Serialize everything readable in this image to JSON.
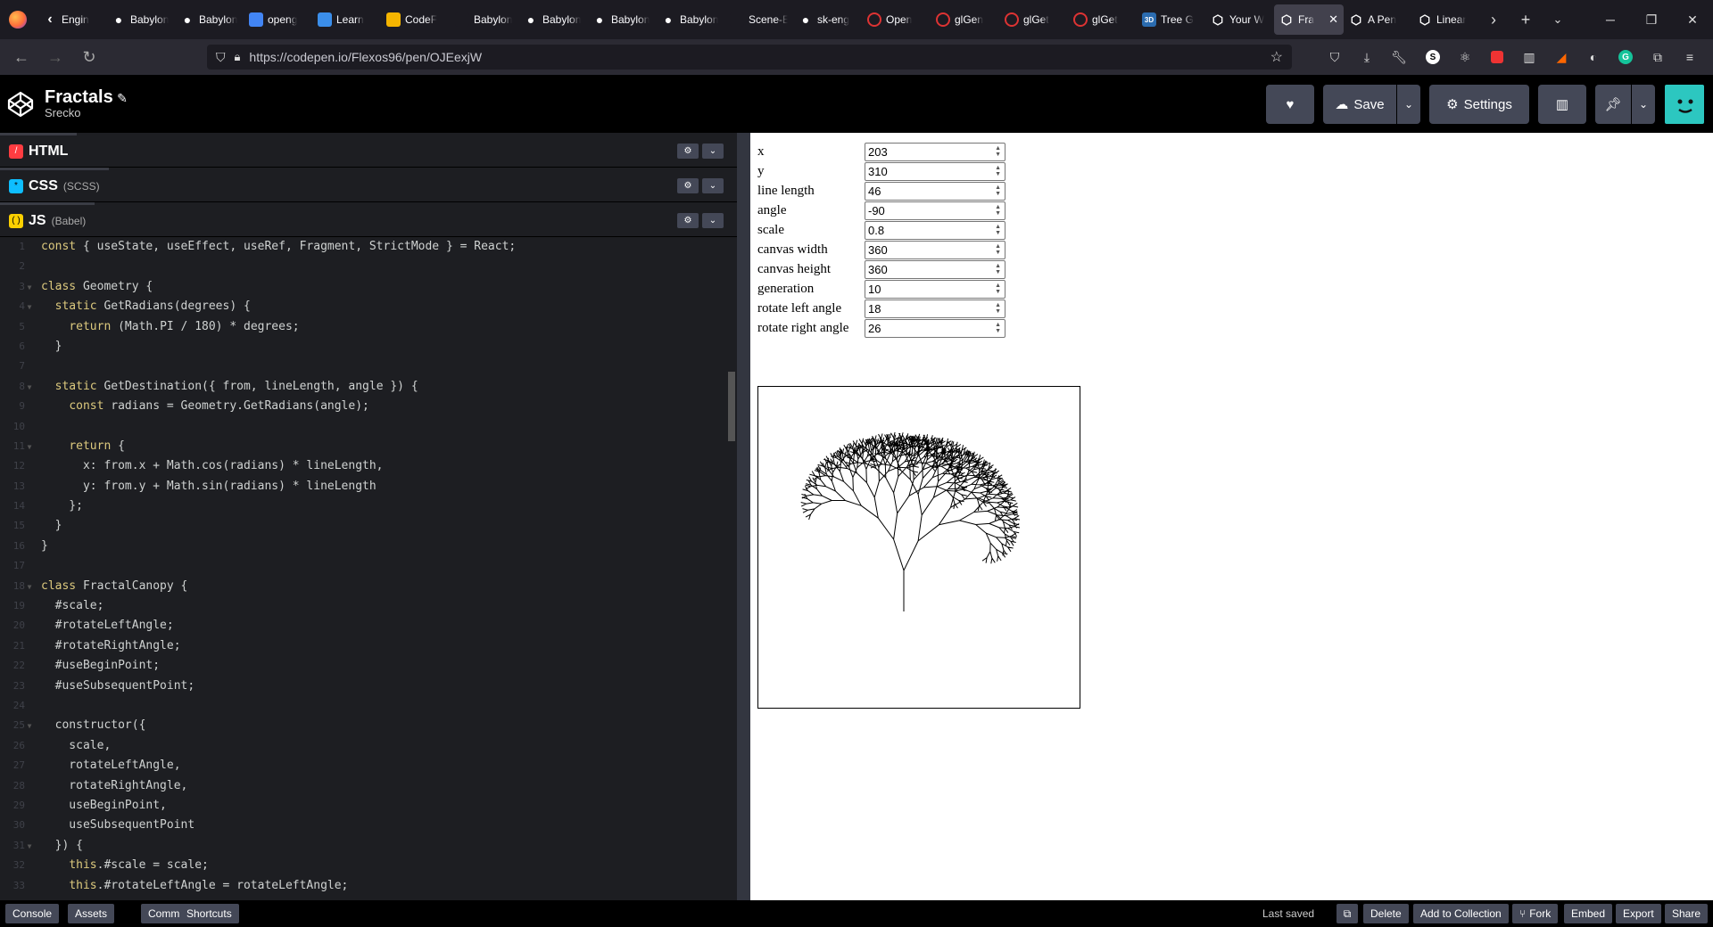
{
  "browser": {
    "tabs": [
      {
        "label": "Engin",
        "icon": "back-icon",
        "color": "#aaa"
      },
      {
        "label": "Babylon",
        "icon": "github-icon",
        "color": "#fff"
      },
      {
        "label": "Babylon",
        "icon": "github-icon",
        "color": "#fff"
      },
      {
        "label": "openg",
        "icon": "google-icon",
        "color": "#4285f4"
      },
      {
        "label": "Learn",
        "icon": "microsoft-icon",
        "color": "#3b8eea"
      },
      {
        "label": "CodeF",
        "icon": "chart-icon",
        "color": "#f4b400"
      },
      {
        "label": "Babylon",
        "icon": "blank-icon",
        "color": "#1c1b22"
      },
      {
        "label": "Babylon",
        "icon": "github-icon",
        "color": "#fff"
      },
      {
        "label": "Babylon",
        "icon": "github-icon",
        "color": "#fff"
      },
      {
        "label": "Babylon",
        "icon": "github-icon",
        "color": "#fff"
      },
      {
        "label": "Scene-Eng",
        "icon": "blank-icon",
        "color": "#1c1b22"
      },
      {
        "label": "sk-eng",
        "icon": "github-icon",
        "color": "#fff"
      },
      {
        "label": "Open",
        "icon": "opengl-icon",
        "color": "#d33"
      },
      {
        "label": "glGen",
        "icon": "opengl-icon",
        "color": "#d33"
      },
      {
        "label": "glGet",
        "icon": "opengl-icon",
        "color": "#d33"
      },
      {
        "label": "glGet",
        "icon": "opengl-icon",
        "color": "#d33"
      },
      {
        "label": "Tree G",
        "icon": "3d-icon",
        "color": "#2b6cb0"
      },
      {
        "label": "Your W",
        "icon": "codepen-icon",
        "color": "#fff"
      },
      {
        "label": "Fra",
        "icon": "codepen-icon",
        "color": "#fff",
        "active": true
      },
      {
        "label": "A Pen",
        "icon": "codepen-icon",
        "color": "#fff"
      },
      {
        "label": "Linear",
        "icon": "codepen-icon",
        "color": "#fff"
      }
    ],
    "url": "https://codepen.io/Flexos96/pen/OJEexjW"
  },
  "header": {
    "title": "Fractals",
    "author": "Srecko",
    "save_label": "Save",
    "settings_label": "Settings"
  },
  "editors": {
    "html_label": "HTML",
    "css_label": "CSS",
    "css_sub": "(SCSS)",
    "js_label": "JS",
    "js_sub": "(Babel)"
  },
  "code_lines": [
    {
      "n": "1",
      "t": "const { useState, useEffect, useRef, Fragment, StrictMode } = React;"
    },
    {
      "n": "2",
      "t": ""
    },
    {
      "n": "3",
      "t": "class Geometry {",
      "f": true
    },
    {
      "n": "4",
      "t": "  static GetRadians(degrees) {",
      "f": true
    },
    {
      "n": "5",
      "t": "    return (Math.PI / 180) * degrees;"
    },
    {
      "n": "6",
      "t": "  }"
    },
    {
      "n": "7",
      "t": ""
    },
    {
      "n": "8",
      "t": "  static GetDestination({ from, lineLength, angle }) {",
      "f": true
    },
    {
      "n": "9",
      "t": "    const radians = Geometry.GetRadians(angle);"
    },
    {
      "n": "10",
      "t": ""
    },
    {
      "n": "11",
      "t": "    return {",
      "f": true
    },
    {
      "n": "12",
      "t": "      x: from.x + Math.cos(radians) * lineLength,"
    },
    {
      "n": "13",
      "t": "      y: from.y + Math.sin(radians) * lineLength"
    },
    {
      "n": "14",
      "t": "    };"
    },
    {
      "n": "15",
      "t": "  }"
    },
    {
      "n": "16",
      "t": "}"
    },
    {
      "n": "17",
      "t": ""
    },
    {
      "n": "18",
      "t": "class FractalCanopy {",
      "f": true
    },
    {
      "n": "19",
      "t": "  #scale;"
    },
    {
      "n": "20",
      "t": "  #rotateLeftAngle;"
    },
    {
      "n": "21",
      "t": "  #rotateRightAngle;"
    },
    {
      "n": "22",
      "t": "  #useBeginPoint;"
    },
    {
      "n": "23",
      "t": "  #useSubsequentPoint;"
    },
    {
      "n": "24",
      "t": ""
    },
    {
      "n": "25",
      "t": "  constructor({",
      "f": true
    },
    {
      "n": "26",
      "t": "    scale,"
    },
    {
      "n": "27",
      "t": "    rotateLeftAngle,"
    },
    {
      "n": "28",
      "t": "    rotateRightAngle,"
    },
    {
      "n": "29",
      "t": "    useBeginPoint,"
    },
    {
      "n": "30",
      "t": "    useSubsequentPoint"
    },
    {
      "n": "31",
      "t": "  }) {",
      "f": true
    },
    {
      "n": "32",
      "t": "    this.#scale = scale;"
    },
    {
      "n": "33",
      "t": "    this.#rotateLeftAngle = rotateLeftAngle;"
    }
  ],
  "form": [
    {
      "label": "x",
      "value": "203"
    },
    {
      "label": "y",
      "value": "310"
    },
    {
      "label": "line length",
      "value": "46"
    },
    {
      "label": "angle",
      "value": "-90"
    },
    {
      "label": "scale",
      "value": "0.8"
    },
    {
      "label": "canvas width",
      "value": "360"
    },
    {
      "label": "canvas height",
      "value": "360"
    },
    {
      "label": "generation",
      "value": "10"
    },
    {
      "label": "rotate left angle",
      "value": "18"
    },
    {
      "label": "rotate right angle",
      "value": "26"
    }
  ],
  "footer": {
    "console": "Console",
    "assets": "Assets",
    "comments": "Comments",
    "shortcuts": "Shortcuts",
    "last_saved": "Last saved",
    "delete": "Delete",
    "add_to_collection": "Add to Collection",
    "fork": "Fork",
    "embed": "Embed",
    "export": "Export",
    "share": "Share"
  }
}
